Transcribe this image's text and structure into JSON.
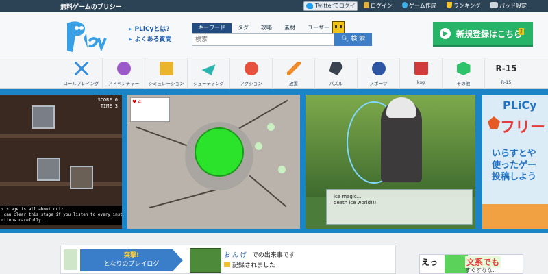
{
  "topbar": {
    "site_name": "無料ゲームのプリシー",
    "twitter_login": "Twitterでログイン",
    "login": "ログイン",
    "game_create": "ゲーム作成",
    "ranking": "ランキング",
    "pad_settings": "パッド設定"
  },
  "header": {
    "logo_text": "PLiCy",
    "link_about": "PLiCyとは?",
    "link_faq": "よくある質問",
    "search_tabs": [
      "キーワード",
      "タグ",
      "攻略",
      "素材",
      "ユーザー"
    ],
    "search_placeholder": "検索",
    "search_button": "検 索",
    "signup_button": "新規登録はこちら",
    "signup_badge": "ﾇ"
  },
  "categories": [
    {
      "label": "ロールプレイング",
      "icon": "sword-icon"
    },
    {
      "label": "アドベンチャー",
      "icon": "adventure-icon"
    },
    {
      "label": "シミュレーション",
      "icon": "building-icon"
    },
    {
      "label": "シューティング",
      "icon": "jet-icon"
    },
    {
      "label": "アクション",
      "icon": "splash-icon"
    },
    {
      "label": "放置",
      "icon": "paintbrush-icon"
    },
    {
      "label": "パズル",
      "icon": "puzzle-icon"
    },
    {
      "label": "スポーツ",
      "icon": "ball-icon"
    },
    {
      "label": "ksg",
      "icon": "trash-icon"
    },
    {
      "label": "その他",
      "icon": "hexagon-icon"
    },
    {
      "label": "R-15",
      "icon": "r15-text",
      "glyph": "R-15"
    }
  ],
  "carousel": {
    "slide1": {
      "score_label": "SCORE",
      "score_value": "0",
      "time_label": "TIME",
      "time_value": "3",
      "message": "s stage is all about quiz...\n can clear this stage if you listen to every instr\nctions carefully..."
    },
    "slide2": {
      "card_count": "4"
    },
    "slide3": {
      "dialog_line1": "ice magic...",
      "dialog_line2": "death ice world!!!"
    },
    "slide4": {
      "title": "PLiCy",
      "subtitle": "フリー",
      "line1": "いらすとや",
      "line2": "使ったゲー",
      "line3": "投稿しよう"
    }
  },
  "feed": {
    "label_top": "突撃!",
    "label_bottom": "となりのプレイログ",
    "user_name": "お ん げ",
    "event_text": "での出来事です",
    "record_text": "記録されました"
  },
  "ad": {
    "left_text": "えっ",
    "badge_text": "文系でも",
    "sub_text": "すぐすなな.."
  },
  "colors": {
    "topbar": "#2c4356",
    "accent_blue": "#1a84c7",
    "signup_green": "#27b468",
    "search_tab_active": "#234d80"
  }
}
